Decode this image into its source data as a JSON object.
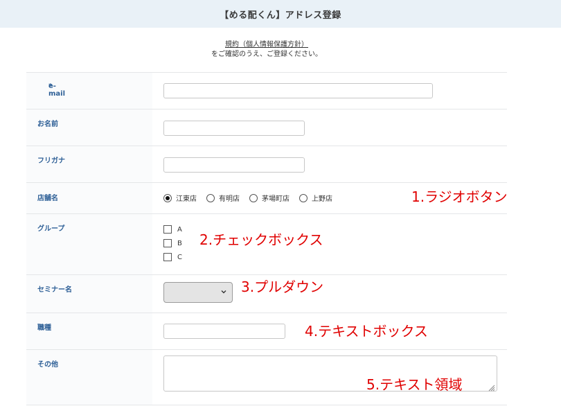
{
  "header": {
    "title": "【める配くん】アドレス登録"
  },
  "intro": {
    "policy_link": "規約（個人情報保護方針）",
    "confirm_text": "をご確認のうえ、ご登録ください。"
  },
  "form": {
    "email": {
      "label": "e-mail",
      "required_mark": "*",
      "value": ""
    },
    "name": {
      "label": "お名前",
      "value": ""
    },
    "furigana": {
      "label": "フリガナ",
      "value": ""
    },
    "store": {
      "label": "店舗名",
      "options": [
        "江東店",
        "有明店",
        "茅場町店",
        "上野店"
      ],
      "selected": "江東店"
    },
    "group": {
      "label": "グループ",
      "options": [
        "A",
        "B",
        "C"
      ]
    },
    "seminar": {
      "label": "セミナー名",
      "selected": ""
    },
    "occupation": {
      "label": "職種",
      "value": ""
    },
    "other": {
      "label": "その他",
      "value": ""
    }
  },
  "annotations": {
    "radio": "1.ラジオボタン",
    "checkbox": "2.チェックボックス",
    "pulldown": "3.プルダウン",
    "textbox": "4.テキストボックス",
    "textarea": "5.テキスト領域"
  },
  "colors": {
    "header_bg": "#e9f1f7",
    "label_text": "#2d5f96",
    "annotation": "#e00000",
    "required": "#d0021b"
  }
}
